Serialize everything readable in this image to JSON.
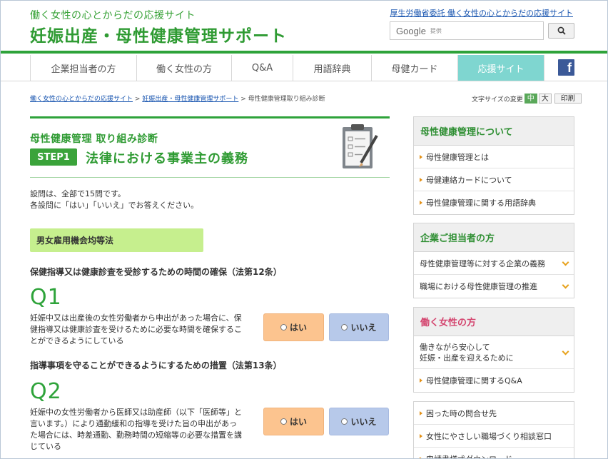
{
  "header": {
    "tagline": "働く女性の心とからだの応援サイト",
    "title": "妊娠出産・母性健康管理サポート",
    "top_link": "厚生労働省委託 働く女性の心とからだの応援サイト",
    "search_brand": "Google",
    "search_sub": "提供"
  },
  "nav": {
    "items": [
      {
        "label": "企業担当者の方"
      },
      {
        "label": "働く女性の方"
      },
      {
        "label": "Q&A"
      },
      {
        "label": "用語辞典"
      },
      {
        "label": "母健カード"
      },
      {
        "label": "応援サイト"
      }
    ],
    "facebook": "f"
  },
  "breadcrumb": {
    "home": "働く女性の心とからだの応援サイト",
    "section": "妊娠出産・母性健康管理サポート",
    "current": "母性健康管理取り組み診断",
    "sep": ">"
  },
  "font_size": {
    "label": "文字サイズの変更",
    "medium": "中",
    "large": "大",
    "print": "印刷"
  },
  "main": {
    "subtitle": "母性健康管理 取り組み診断",
    "step": "STEP1",
    "step_title": "法律における事業主の義務",
    "intro1": "設問は、全部で15問です。",
    "intro2": "各設問に「はい」「いいえ」でお答えください。",
    "law": "男女雇用機会均等法",
    "questions": [
      {
        "heading": "保健指導又は健康診査を受診するための時間の確保（法第12条）",
        "num": "Q1",
        "text": "妊娠中又は出産後の女性労働者から申出があった場合に、保健指導又は健康診査を受けるために必要な時間を確保することができるようにしている",
        "yes": "はい",
        "no": "いいえ"
      },
      {
        "heading": "指導事項を守ることができるようにするための措置（法第13条）",
        "num": "Q2",
        "text": "妊娠中の女性労働者から医師又は助産師（以下「医師等」と言います。）により通勤緩和の指導を受けた旨の申出があった場合には、時差通勤、勤務時間の短縮等の必要な措置を講じている",
        "yes": "はい",
        "no": "いいえ"
      }
    ]
  },
  "sidebar": {
    "box1": {
      "title": "母性健康管理について",
      "items": [
        "母性健康管理とは",
        "母健連絡カードについて",
        "母性健康管理に関する用語辞典"
      ]
    },
    "box2": {
      "title": "企業ご担当者の方",
      "items": [
        "母性健康管理等に対する企業の義務",
        "職場における母性健康管理の推進"
      ]
    },
    "box3": {
      "title": "働く女性の方",
      "item1_line1": "働きながら安心して",
      "item1_line2": "妊娠・出産を迎えるために",
      "item2": "母性健康管理に関するQ&A"
    },
    "box4": {
      "items": [
        "困った時の問合せ先",
        "女性にやさしい職場づくり相談窓口",
        "申請書様式ダウンロード"
      ]
    }
  },
  "colors": {
    "brand_green": "#2ea33a",
    "active_tab": "#7fd6d0",
    "yes_button": "#fcc48f",
    "no_button": "#b7c9ea",
    "law_box": "#c6ef8e"
  }
}
